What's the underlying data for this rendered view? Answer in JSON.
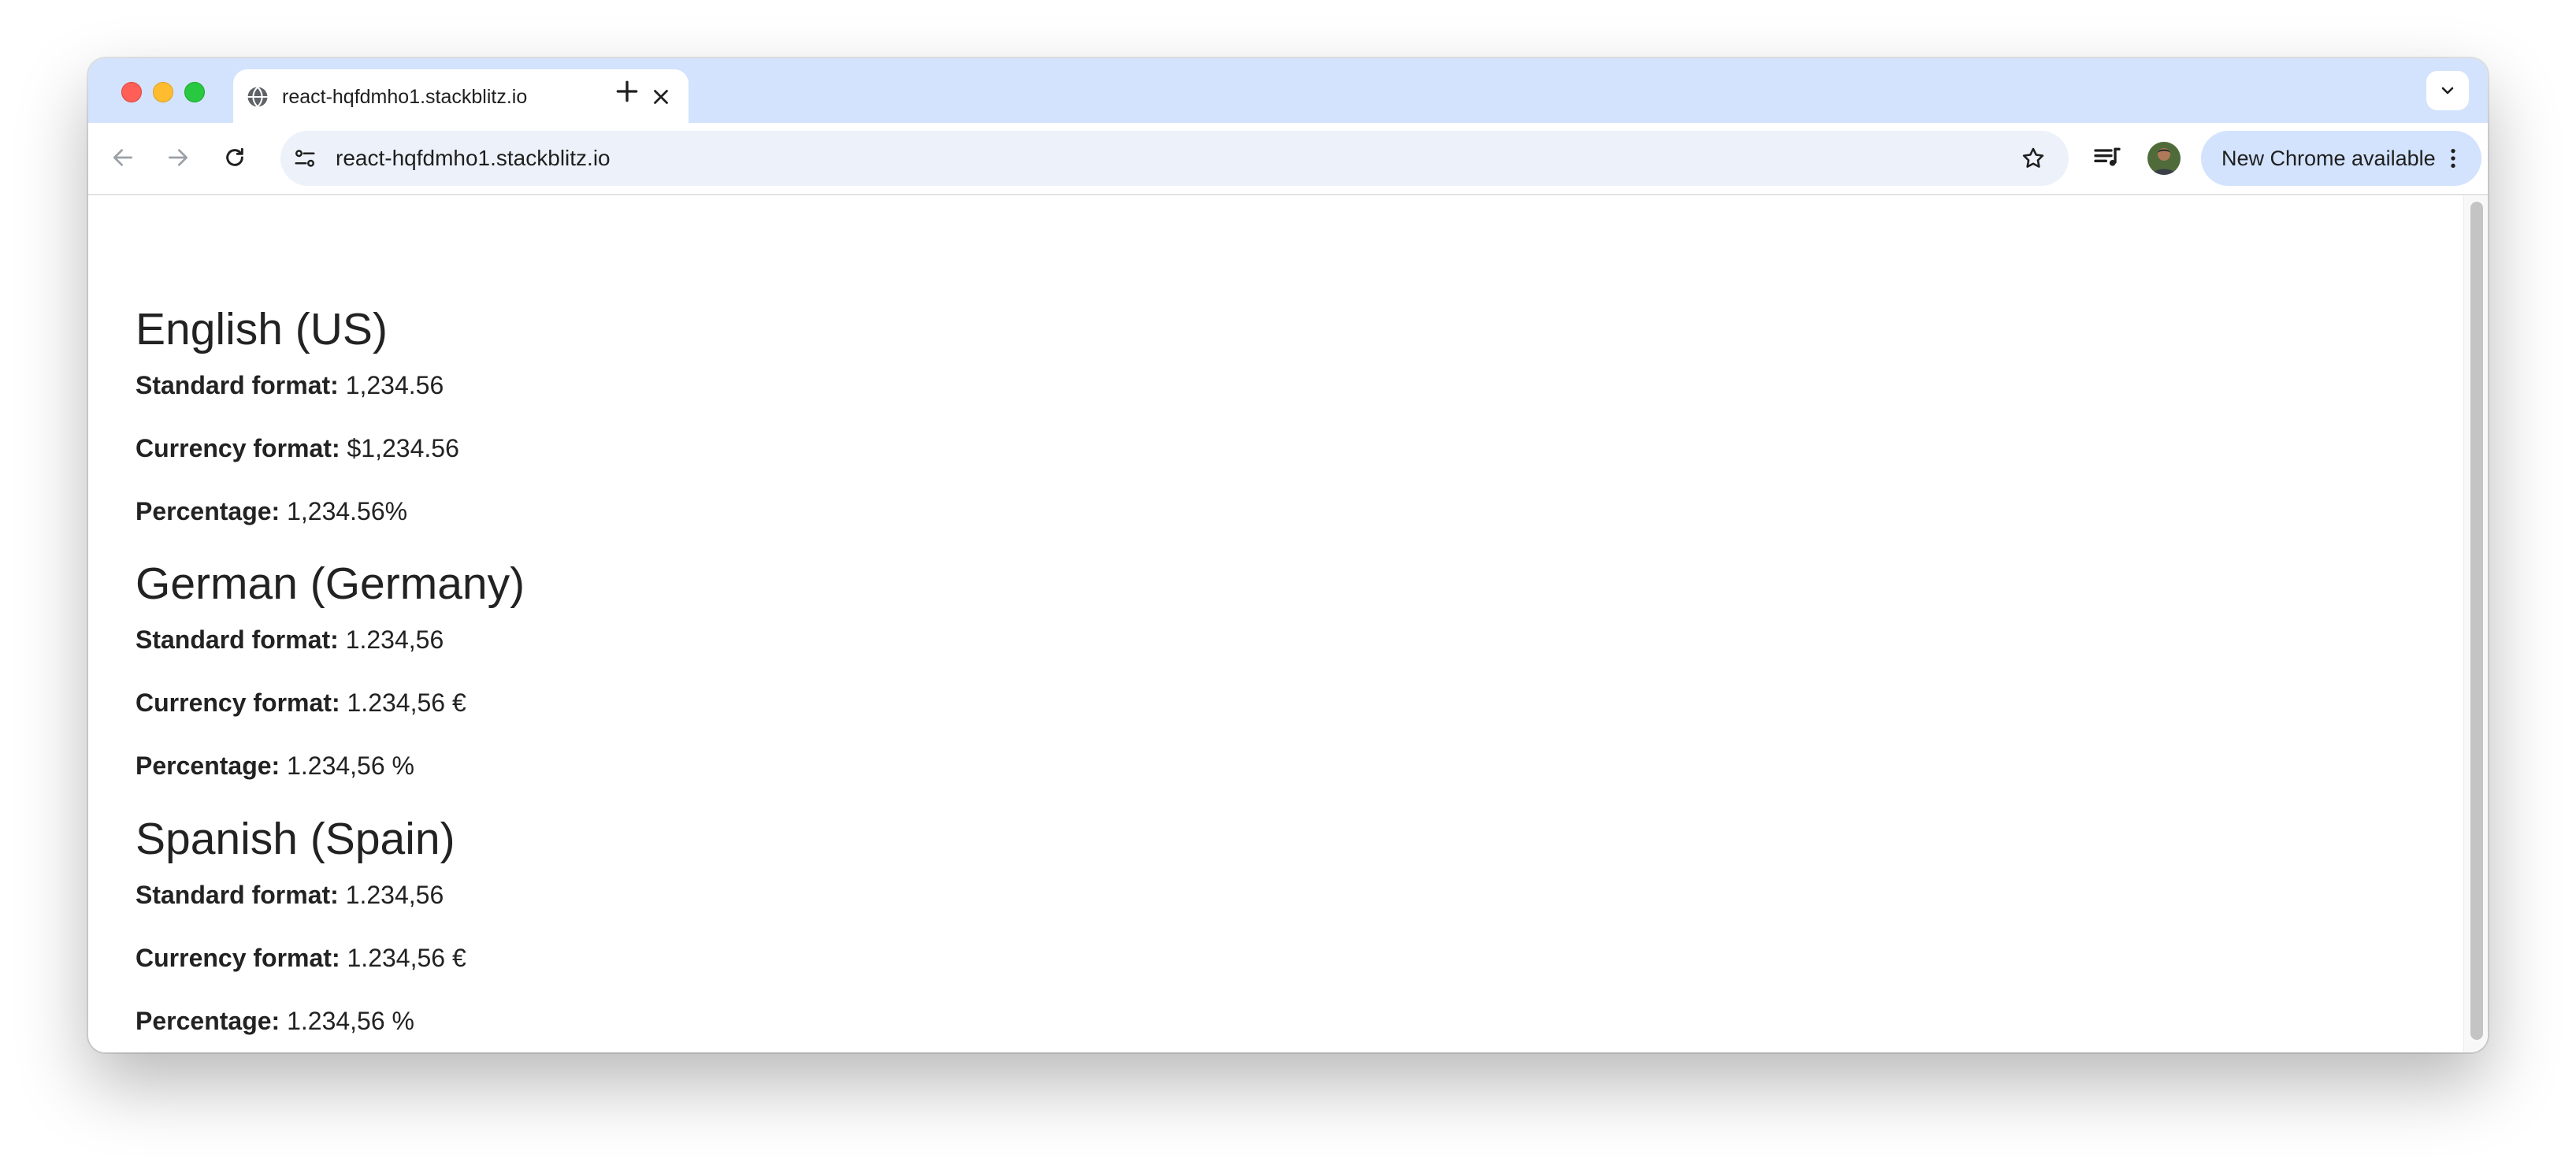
{
  "browser": {
    "tab_title": "react-hqfdmho1.stackblitz.io",
    "url": "react-hqfdmho1.stackblitz.io",
    "update_chip_label": "New Chrome available"
  },
  "icons": {
    "window_close": "traffic-light-red",
    "window_minimize": "traffic-light-yellow",
    "window_zoom": "traffic-light-green",
    "favicon": "globe-icon",
    "tab_close": "close-icon",
    "new_tab": "plus-icon",
    "tab_search": "chevron-down-icon",
    "back": "arrow-left-icon",
    "forward": "arrow-right-icon",
    "reload": "reload-icon",
    "site_info": "tune-icon",
    "bookmark": "star-icon",
    "media": "playlist-icon",
    "menu": "kebab-menu-icon"
  },
  "sections": [
    {
      "title": "English (US)",
      "rows": [
        {
          "label": "Standard format:",
          "value": "1,234.56"
        },
        {
          "label": "Currency format:",
          "value": "$1,234.56"
        },
        {
          "label": "Percentage:",
          "value": "1,234.56%"
        }
      ]
    },
    {
      "title": "German (Germany)",
      "rows": [
        {
          "label": "Standard format:",
          "value": "1.234,56"
        },
        {
          "label": "Currency format:",
          "value": "1.234,56 €"
        },
        {
          "label": "Percentage:",
          "value": "1.234,56 %"
        }
      ]
    },
    {
      "title": "Spanish (Spain)",
      "rows": [
        {
          "label": "Standard format:",
          "value": "1.234,56"
        },
        {
          "label": "Currency format:",
          "value": "1.234,56 €"
        },
        {
          "label": "Percentage:",
          "value": "1.234,56 %"
        }
      ]
    }
  ],
  "colors": {
    "tab_strip": "#d3e3fd",
    "omnibox": "#edf2fa",
    "text": "#222222"
  }
}
